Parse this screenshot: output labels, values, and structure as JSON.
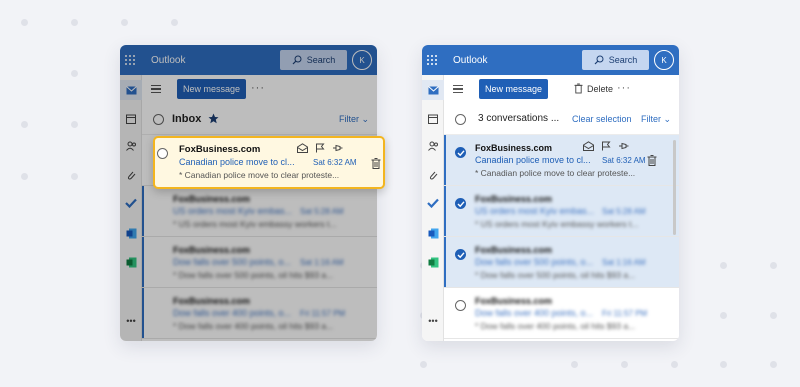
{
  "colors": {
    "brand_blue": "#2f6ec1",
    "highlight_border": "#f3b51f",
    "selected_row": "#dde8f5"
  },
  "app": {
    "title": "Outlook",
    "search_label": "Search",
    "avatar_initial": "K",
    "more_label": "•••",
    "rail_icons": [
      "mail-icon",
      "calendar-icon",
      "people-icon",
      "attachment-icon",
      "todo-icon",
      "word-icon",
      "excel-icon",
      "more-apps-icon"
    ]
  },
  "panel_single": {
    "new_message_label": "New message",
    "toolbar_more": "···",
    "inbox_title": "Inbox",
    "filter_label": "Filter",
    "highlighted_email": {
      "sender": "FoxBusiness.com",
      "subject": "Canadian police move to cl...",
      "time": "Sat 6:32 AM",
      "preview": "* Canadian police move to clear proteste..."
    },
    "emails": [
      {
        "sender": "FoxBusiness.com",
        "subject": "US orders most Kyiv embas...",
        "time": "Sat 5:28 AM",
        "preview": "* US orders most Kyiv embassy workers t..."
      },
      {
        "sender": "FoxBusiness.com",
        "subject": "Dow falls over 500 points, o...",
        "time": "Sat 1:16 AM",
        "preview": "* Dow falls over 500 points, oil hits $93 a..."
      },
      {
        "sender": "FoxBusiness.com",
        "subject": "Dow falls over 400 points, o...",
        "time": "Fri 11:57 PM",
        "preview": "* Dow falls over 400 points, oil hits $93 a..."
      }
    ]
  },
  "panel_multi": {
    "new_message_label": "New message",
    "delete_label": "Delete",
    "toolbar_more": "···",
    "conversation_count": "3 conversations ...",
    "clear_selection_label": "Clear selection",
    "filter_label": "Filter",
    "emails": [
      {
        "sender": "FoxBusiness.com",
        "subject": "Canadian police move to cl...",
        "time": "Sat 6:32 AM",
        "preview": "* Canadian police move to clear proteste...",
        "selected": true
      },
      {
        "sender": "FoxBusiness.com",
        "subject": "US orders most Kyiv embas...",
        "time": "Sat 5:28 AM",
        "preview": "* US orders most Kyiv embassy workers t...",
        "selected": true
      },
      {
        "sender": "FoxBusiness.com",
        "subject": "Dow falls over 500 points, o...",
        "time": "Sat 1:16 AM",
        "preview": "* Dow falls over 500 points, oil hits $93 a...",
        "selected": true
      },
      {
        "sender": "FoxBusiness.com",
        "subject": "Dow falls over 400 points, o...",
        "time": "Fri 11:57 PM",
        "preview": "* Dow falls over 400 points, oil hits $93 a...",
        "selected": false
      }
    ]
  }
}
